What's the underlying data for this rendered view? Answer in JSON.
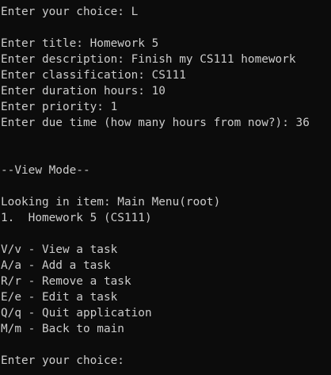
{
  "console": {
    "lines": [
      "Enter your choice: L",
      "",
      "Enter title: Homework 5",
      "Enter description: Finish my CS111 homework",
      "Enter classification: CS111",
      "Enter duration hours: 10",
      "Enter priority: 1",
      "Enter due time (how many hours from now?): 36",
      "",
      "",
      "--View Mode--",
      "",
      "Looking in item: Main Menu(root)",
      "1.  Homework 5 (CS111)",
      "",
      "V/v - View a task",
      "A/a - Add a task",
      "R/r - Remove a task",
      "E/e - Edit a task",
      "Q/q - Quit application",
      "M/m - Back to main",
      "",
      "Enter your choice: "
    ]
  },
  "colors": {
    "background": "#0c0c0c",
    "text": "#cccccc"
  }
}
